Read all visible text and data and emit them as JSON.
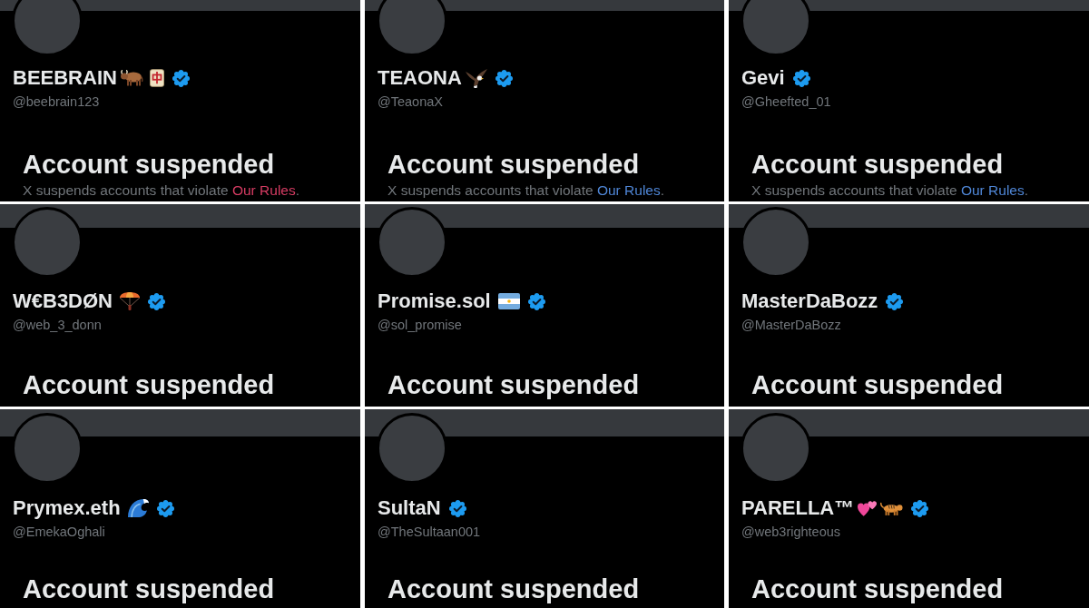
{
  "profiles": [
    {
      "name": "BEEBRAIN",
      "emoji": [
        {
          "kind": "ox"
        },
        {
          "kind": "mahjong"
        }
      ],
      "verified": true,
      "handle": "@beebrain123",
      "status": "Account suspended",
      "note": {
        "text": "X suspends accounts that violate",
        "link": {
          "text": "Our Rules",
          "color": "#d63c63"
        },
        "end": "."
      }
    },
    {
      "name": "TEAONA",
      "emoji": [
        {
          "kind": "eagle"
        }
      ],
      "verified": true,
      "handle": "@TeaonaX",
      "status": "Account suspended",
      "note": {
        "text": "X suspends accounts that violate",
        "link": {
          "text": "Our Rules",
          "color": "#4f86d6"
        },
        "end": "."
      }
    },
    {
      "name": "Gevi",
      "verified": true,
      "handle": "@Gheefted_01",
      "status": "Account suspended",
      "note": {
        "text": "X suspends accounts that violate",
        "link": {
          "text": "Our Rules",
          "color": "#4f86d6"
        },
        "end": "."
      }
    },
    {
      "name": "W€B3DØN",
      "emoji": [
        {
          "kind": "parachute"
        }
      ],
      "verified": true,
      "handle": "@web_3_donn",
      "status": "Account suspended"
    },
    {
      "name": "Promise.sol",
      "emoji": [
        {
          "kind": "flag"
        }
      ],
      "verified": true,
      "handle": "@sol_promise",
      "status": "Account suspended"
    },
    {
      "name": "MasterDaBozz",
      "verified": true,
      "handle": "@MasterDaBozz",
      "status": "Account suspended"
    },
    {
      "name": "Prymex.eth",
      "emoji": [
        {
          "kind": "wave"
        }
      ],
      "verified": true,
      "handle": "@EmekaOghali",
      "status": "Account suspended"
    },
    {
      "name": "SultaN",
      "verified": true,
      "handle": "@TheSultaan001",
      "status": "Account suspended"
    },
    {
      "name": "PARELLA™",
      "emoji": [
        {
          "kind": "hearts"
        },
        {
          "kind": "tiger"
        }
      ],
      "verified": true,
      "handle": "@web3righteous",
      "status": "Account suspended"
    }
  ]
}
